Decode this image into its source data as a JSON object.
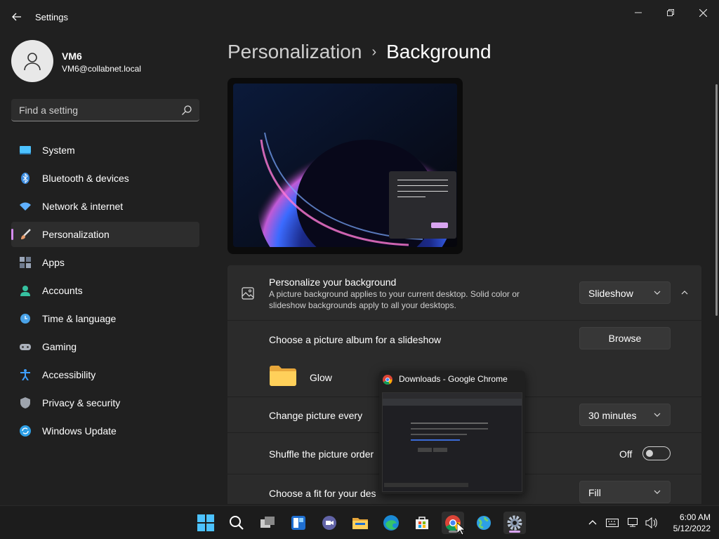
{
  "window": {
    "title": "Settings",
    "controls": {
      "minimize": "─",
      "maximize": "❐",
      "close": "✕"
    }
  },
  "user": {
    "name": "VM6",
    "email": "VM6@collabnet.local"
  },
  "search": {
    "placeholder": "Find a setting"
  },
  "sidebar": {
    "items": [
      {
        "label": "System",
        "icon": "system-icon",
        "color": "#4cc2ff"
      },
      {
        "label": "Bluetooth & devices",
        "icon": "bluetooth-icon",
        "color": "#3a8be0"
      },
      {
        "label": "Network & internet",
        "icon": "wifi-icon",
        "color": "#5fb0ff"
      },
      {
        "label": "Personalization",
        "icon": "brush-icon",
        "color": "#e59a6b",
        "active": true
      },
      {
        "label": "Apps",
        "icon": "apps-icon",
        "color": "#9aa6b8"
      },
      {
        "label": "Accounts",
        "icon": "accounts-icon",
        "color": "#36c1a0"
      },
      {
        "label": "Time & language",
        "icon": "time-language-icon",
        "color": "#4aa3e8"
      },
      {
        "label": "Gaming",
        "icon": "gaming-icon",
        "color": "#aab0ba"
      },
      {
        "label": "Accessibility",
        "icon": "accessibility-icon",
        "color": "#3ea0ff"
      },
      {
        "label": "Privacy & security",
        "icon": "shield-icon",
        "color": "#9ea4ad"
      },
      {
        "label": "Windows Update",
        "icon": "update-icon",
        "color": "#2d9fe6"
      }
    ]
  },
  "breadcrumb": {
    "parent": "Personalization",
    "separator": "›",
    "current": "Background"
  },
  "background": {
    "personalize": {
      "title": "Personalize your background",
      "description": "A picture background applies to your current desktop. Solid color or slideshow backgrounds apply to all your desktops.",
      "value": "Slideshow"
    },
    "album": {
      "title": "Choose a picture album for a slideshow",
      "button": "Browse",
      "folder": "Glow"
    },
    "interval": {
      "title": "Change picture every",
      "value": "30 minutes"
    },
    "shuffle": {
      "title": "Shuffle the picture order",
      "state": "Off"
    },
    "fit": {
      "title": "Choose a fit for your des",
      "value": "Fill"
    }
  },
  "thumbnail": {
    "title": "Downloads - Google Chrome"
  },
  "taskbar": {
    "apps": [
      {
        "name": "start-icon"
      },
      {
        "name": "search-icon"
      },
      {
        "name": "task-view-icon"
      },
      {
        "name": "widgets-icon"
      },
      {
        "name": "teams-chat-icon"
      },
      {
        "name": "file-explorer-icon"
      },
      {
        "name": "edge-icon"
      },
      {
        "name": "store-icon"
      },
      {
        "name": "chrome-icon"
      },
      {
        "name": "network-globe-icon"
      },
      {
        "name": "settings-icon"
      }
    ],
    "time": "6:00 AM",
    "date": "5/12/2022"
  },
  "colors": {
    "accent": "#d58cf0",
    "bg": "#202020",
    "card": "#2b2b2b"
  }
}
